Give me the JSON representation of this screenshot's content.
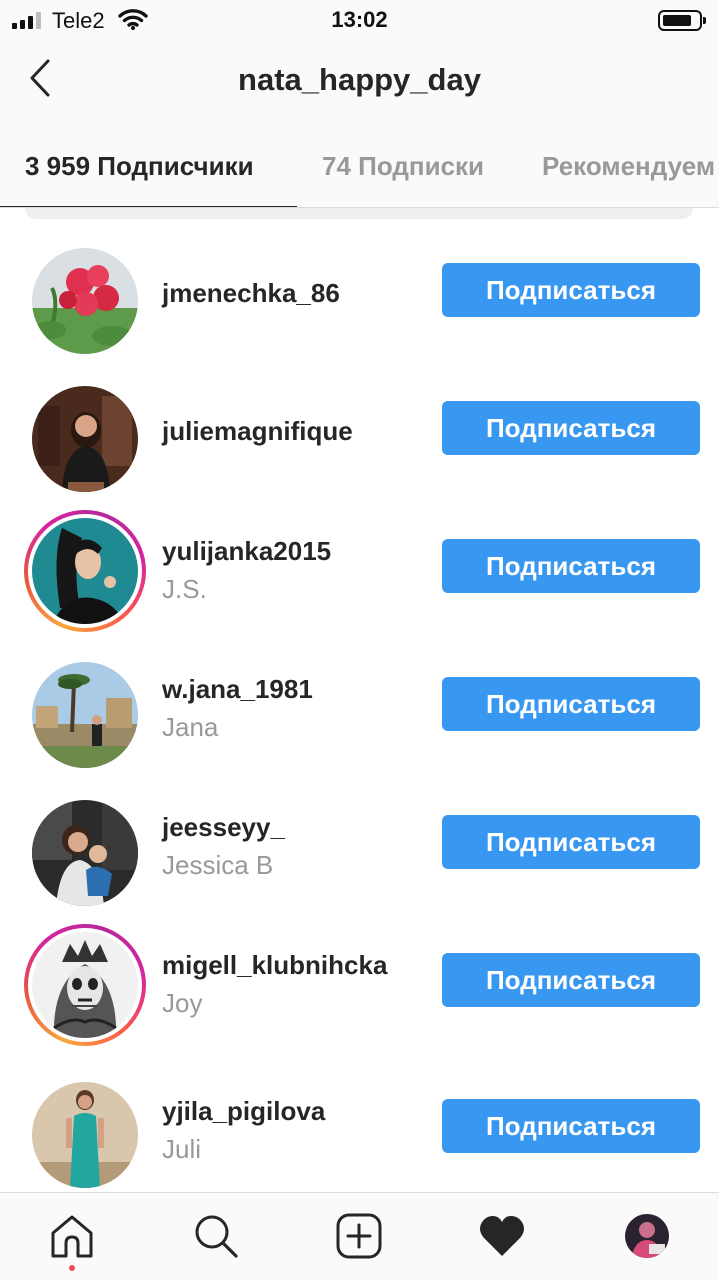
{
  "status_bar": {
    "carrier": "Tele2",
    "time": "13:02",
    "signal_icon": "cellular-signal-icon",
    "wifi_icon": "wifi-icon",
    "battery_icon": "battery-icon"
  },
  "header": {
    "title": "nata_happy_day",
    "back_icon": "chevron-left-icon"
  },
  "tabs": [
    {
      "label": "3 959 Подписчики",
      "active": true
    },
    {
      "label": "74 Подписки",
      "active": false
    },
    {
      "label": "Рекомендуем",
      "active": false
    }
  ],
  "followers": [
    {
      "username": "jmenechka_86",
      "fullname": "",
      "button": "Подписаться",
      "story_ring": false
    },
    {
      "username": "juliemagnifique",
      "fullname": "",
      "button": "Подписаться",
      "story_ring": false
    },
    {
      "username": "yulijanka2015",
      "fullname": "J.S.",
      "button": "Подписаться",
      "story_ring": true
    },
    {
      "username": "w.jana_1981",
      "fullname": "Jana",
      "button": "Подписаться",
      "story_ring": false
    },
    {
      "username": "jeesseyy_",
      "fullname": "Jessica B",
      "button": "Подписаться",
      "story_ring": false
    },
    {
      "username": "migell_klubnihcka",
      "fullname": "Joy",
      "button": "Подписаться",
      "story_ring": true
    },
    {
      "username": "yjila_pigilova",
      "fullname": "Juli",
      "button": "Подписаться",
      "story_ring": false
    }
  ],
  "bottom_nav": [
    {
      "icon": "home-icon",
      "active": true
    },
    {
      "icon": "search-icon",
      "active": false
    },
    {
      "icon": "add-post-icon",
      "active": false
    },
    {
      "icon": "heart-icon",
      "active": false
    },
    {
      "icon": "profile-avatar-icon",
      "active": false
    }
  ],
  "colors": {
    "follow_button": "#3897f0",
    "secondary_text": "#999999",
    "primary_text": "#262626",
    "notification_dot": "#ed4956"
  }
}
